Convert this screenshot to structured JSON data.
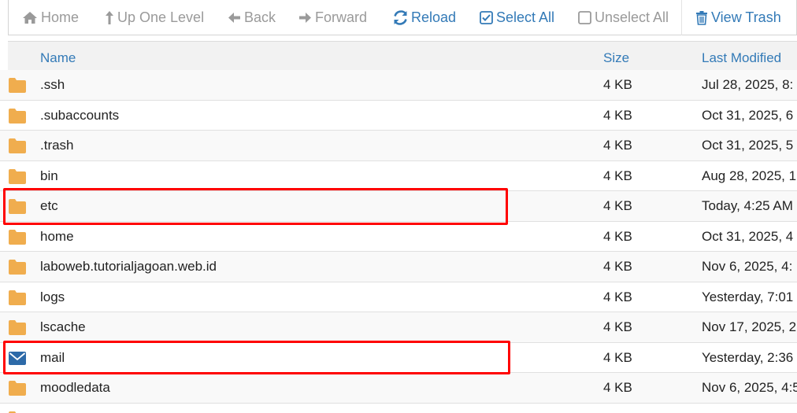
{
  "toolbar": {
    "home": "Home",
    "up_one_level": "Up One Level",
    "back": "Back",
    "forward": "Forward",
    "reload": "Reload",
    "select_all": "Select All",
    "unselect_all": "Unselect All",
    "view_trash": "View Trash"
  },
  "columns": {
    "name": "Name",
    "size": "Size",
    "last_modified": "Last Modified"
  },
  "rows": [
    {
      "name": ".ssh",
      "size": "4 KB",
      "modified": "Jul 28, 2025, 8:",
      "icon": "folder-icon"
    },
    {
      "name": ".subaccounts",
      "size": "4 KB",
      "modified": "Oct 31, 2025, 6",
      "icon": "folder-icon"
    },
    {
      "name": ".trash",
      "size": "4 KB",
      "modified": "Oct 31, 2025, 5",
      "icon": "folder-icon"
    },
    {
      "name": "bin",
      "size": "4 KB",
      "modified": "Aug 28, 2025, 1",
      "icon": "folder-icon"
    },
    {
      "name": "etc",
      "size": "4 KB",
      "modified": "Today, 4:25 AM",
      "icon": "folder-icon"
    },
    {
      "name": "home",
      "size": "4 KB",
      "modified": "Oct 31, 2025, 4",
      "icon": "folder-icon"
    },
    {
      "name": "laboweb.tutorialjagoan.web.id",
      "size": "4 KB",
      "modified": "Nov 6, 2025, 4:",
      "icon": "folder-icon"
    },
    {
      "name": "logs",
      "size": "4 KB",
      "modified": "Yesterday, 7:01",
      "icon": "folder-icon"
    },
    {
      "name": "lscache",
      "size": "4 KB",
      "modified": "Nov 17, 2025, 2",
      "icon": "folder-icon"
    },
    {
      "name": "mail",
      "size": "4 KB",
      "modified": "Yesterday, 2:36",
      "icon": "mail-icon"
    },
    {
      "name": "moodledata",
      "size": "4 KB",
      "modified": "Nov 6, 2025, 4:5",
      "icon": "folder-icon"
    }
  ],
  "colors": {
    "link": "#337ab7",
    "disabled": "#9a9a9a",
    "folder": "#f0ad4e",
    "highlight": "#ff0000"
  }
}
